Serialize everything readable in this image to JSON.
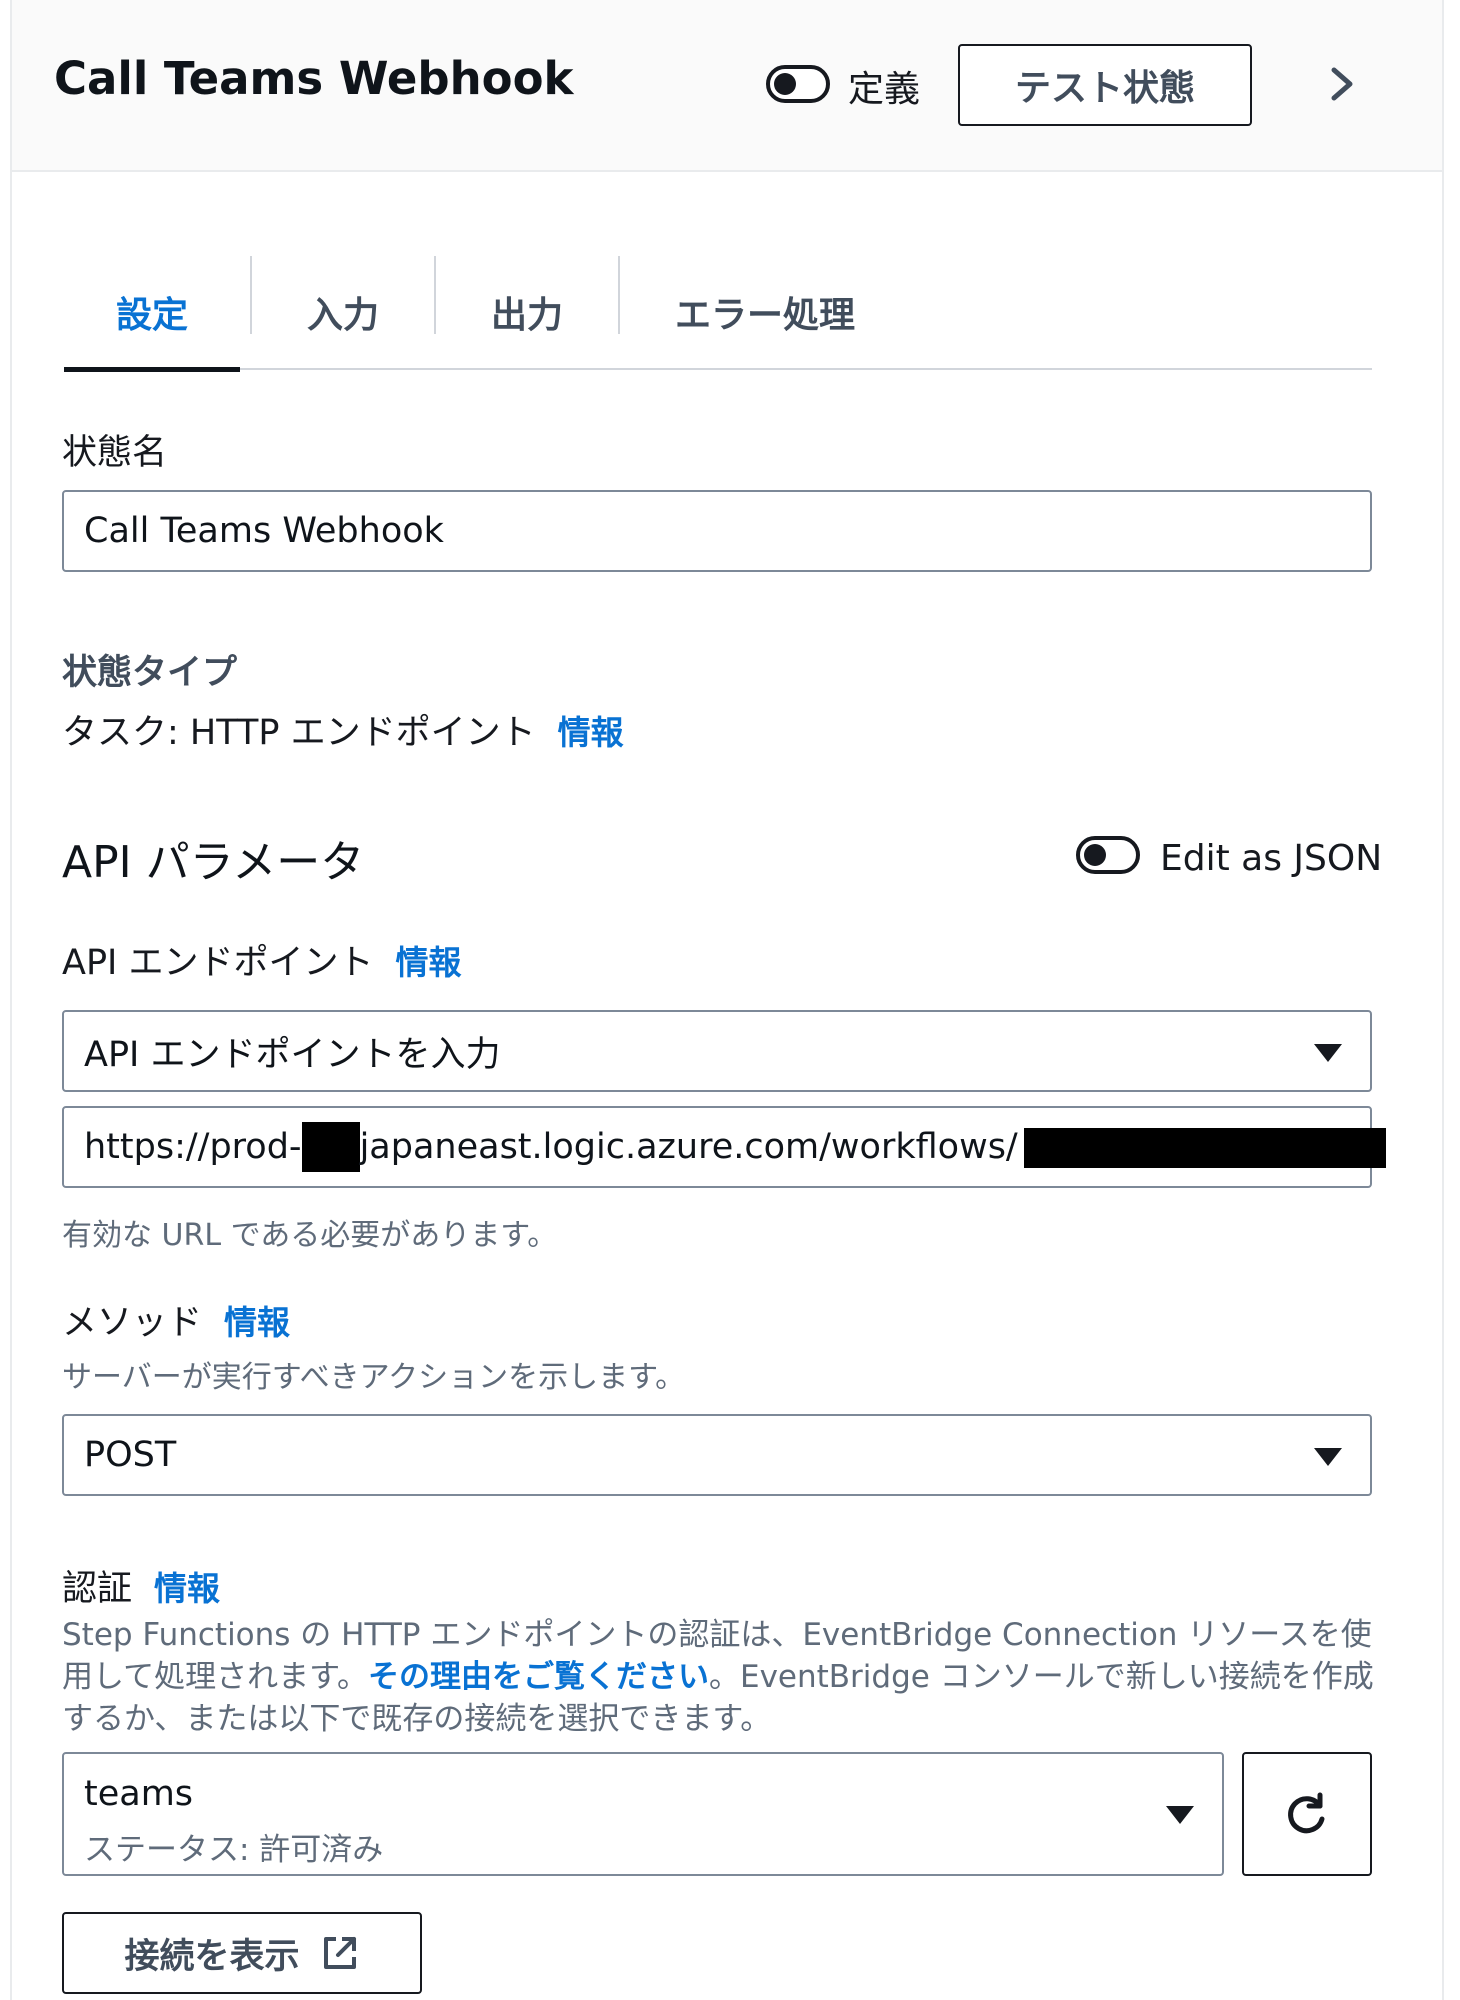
{
  "header": {
    "title": "Call Teams Webhook",
    "definition_toggle_label": "定義",
    "test_state_button": "テスト状態"
  },
  "tabs": [
    {
      "label": "設定",
      "active": true
    },
    {
      "label": "入力",
      "active": false
    },
    {
      "label": "出力",
      "active": false
    },
    {
      "label": "エラー処理",
      "active": false
    }
  ],
  "state_name": {
    "label": "状態名",
    "value": "Call Teams Webhook"
  },
  "state_type": {
    "label": "状態タイプ",
    "value": "タスク: HTTP エンドポイント",
    "info": "情報"
  },
  "api_params": {
    "heading": "API パラメータ",
    "edit_json_label": "Edit as JSON"
  },
  "api_endpoint": {
    "label": "API エンドポイント",
    "info": "情報",
    "select_value": "API エンドポイントを入力",
    "url_part1": "https://prod-",
    "url_part2": "japaneast.logic.azure.com/workflows/",
    "hint": "有効な URL である必要があります。"
  },
  "method": {
    "label": "メソッド",
    "info": "情報",
    "hint": "サーバーが実行すべきアクションを示します。",
    "value": "POST"
  },
  "auth": {
    "label": "認証",
    "info": "情報",
    "desc_part1": "Step Functions の HTTP エンドポイントの認証は、EventBridge Connection リソースを使用して処理されます。",
    "desc_link": "その理由をご覧ください",
    "desc_part2": "。EventBridge コンソールで新しい接続を作成するか、または以下で既存の接続を選択できます。",
    "connection_name": "teams",
    "connection_status": "ステータス: 許可済み",
    "view_connection_button": "接続を表示"
  },
  "icons": [
    "chevron-right-icon",
    "caret-down-icon",
    "refresh-icon",
    "external-link-icon"
  ],
  "colors": {
    "accent": "#0972d3",
    "text": "#16191f",
    "muted": "#5f6b7a",
    "border": "#7d8998"
  }
}
